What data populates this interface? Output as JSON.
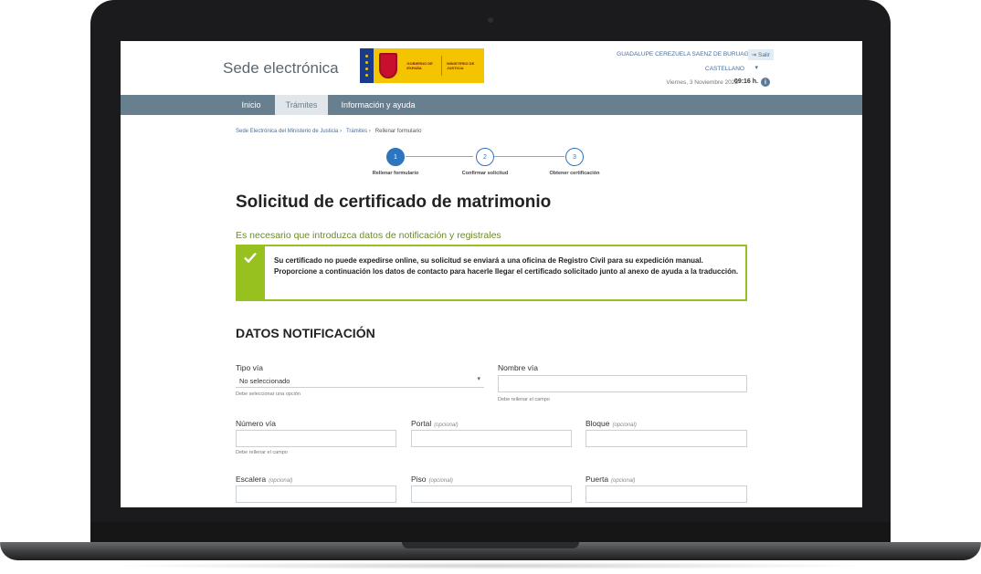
{
  "header": {
    "brand": "Sede electrónica",
    "logo_gobierno": "GOBIERNO DE ESPAÑA",
    "logo_ministerio": "MINISTERIO DE JUSTICIA",
    "user_name": "GUADALUPE CEREZUELA SAENZ DE BURUAGA",
    "logout_label": "Salir",
    "language": "CASTELLANO",
    "date": "Viernes, 3 Noviembre 2023",
    "time": "09:16 h.",
    "info_icon": "info-icon"
  },
  "nav": {
    "items": [
      {
        "label": "Inicio"
      },
      {
        "label": "Trámites",
        "active": true
      },
      {
        "label": "Información y ayuda"
      }
    ]
  },
  "breadcrumb": {
    "items": [
      "Sede Electrónica del Ministerio de Justicia",
      "Trámites",
      "Rellenar formulario"
    ],
    "separator": "›"
  },
  "steps": [
    {
      "number": "1",
      "label": "Rellenar formulario"
    },
    {
      "number": "2",
      "label": "Confirmar solicitud"
    },
    {
      "number": "3",
      "label": "Obtener certificación"
    }
  ],
  "page_title": "Solicitud de certificado de matrimonio",
  "notice": {
    "title": "Es necesario que introduzca datos de notificación y registrales",
    "text": "Su certificado no puede expedirse online, su solicitud se enviará a una oficina de Registro Civil para su expedición manual. Proporcione a continuación los datos de contacto para hacerle llegar el certificado solicitado junto al anexo de ayuda a la traducción.",
    "accent_color": "#96c11f"
  },
  "section_title": "DATOS NOTIFICACIÓN",
  "form": {
    "tipo_via": {
      "label": "Tipo vía",
      "value": "No seleccionado",
      "help": "Debe seleccionar una opción"
    },
    "nombre_via": {
      "label": "Nombre vía",
      "value": "",
      "help": "Debe rellenar el campo"
    },
    "numero_via": {
      "label": "Número vía",
      "value": "",
      "help": "Debe rellenar el campo"
    },
    "portal": {
      "label": "Portal",
      "optional": "(opcional)",
      "value": ""
    },
    "bloque": {
      "label": "Bloque",
      "optional": "(opcional)",
      "value": ""
    },
    "escalera": {
      "label": "Escalera",
      "optional": "(opcional)",
      "value": ""
    },
    "piso": {
      "label": "Piso",
      "optional": "(opcional)",
      "value": ""
    },
    "puerta": {
      "label": "Puerta",
      "optional": "(opcional)",
      "value": ""
    }
  },
  "colors": {
    "nav": "#677f8e",
    "step": "#2e75c0",
    "notice_title": "#6d8a2d"
  }
}
